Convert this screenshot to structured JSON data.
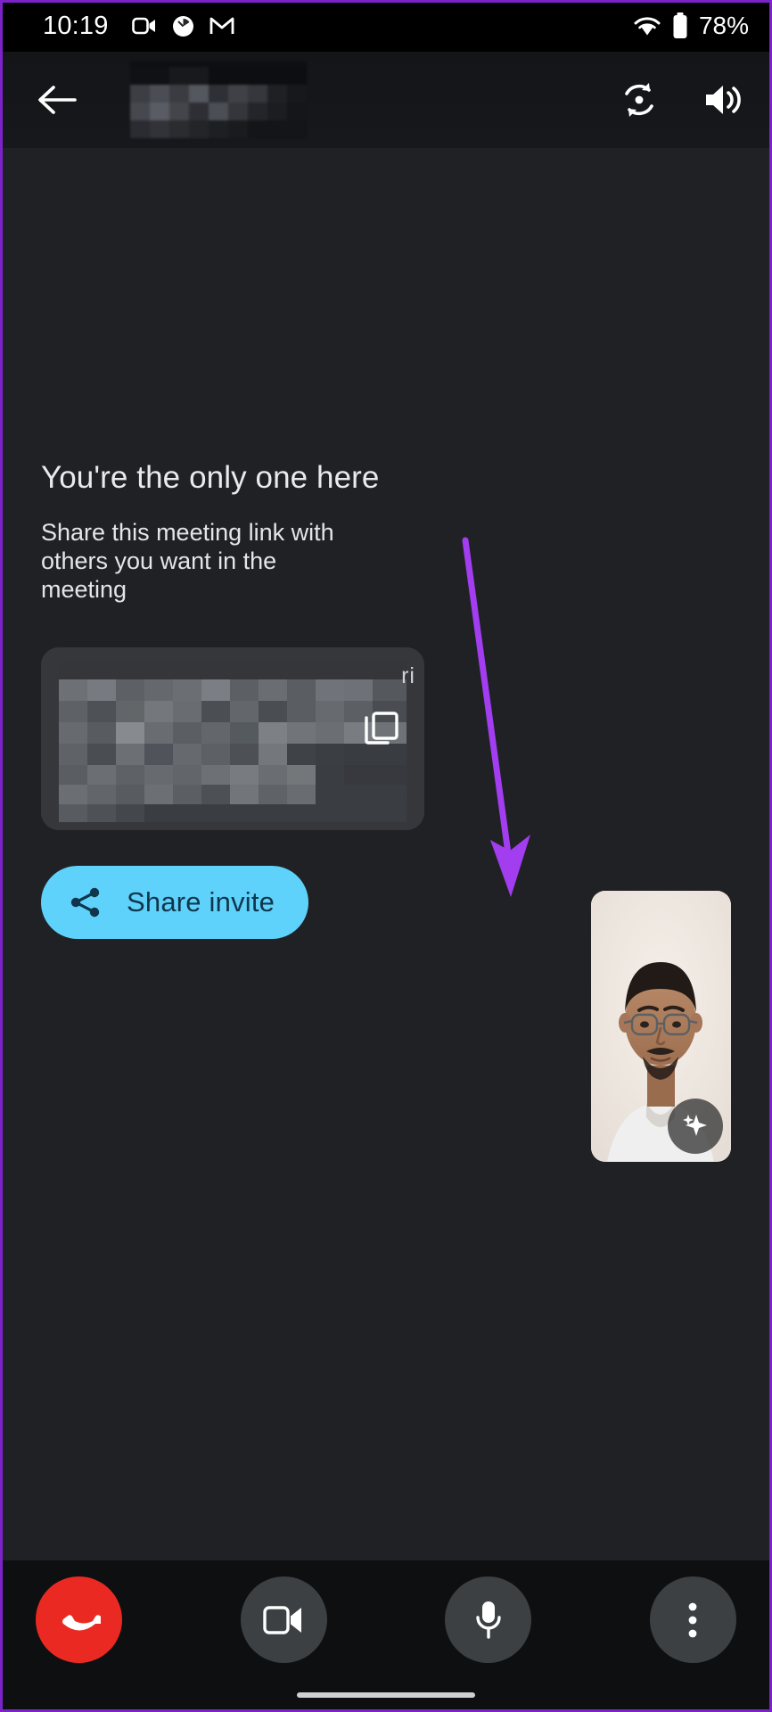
{
  "status_bar": {
    "time": "10:19",
    "battery_percent": "78%",
    "left_icons": [
      "video-camera-icon",
      "clock-circle-icon",
      "gmail-icon"
    ],
    "right_icons": [
      "wifi-icon",
      "battery-icon"
    ]
  },
  "app_bar": {
    "back_icon": "back-arrow-icon",
    "meeting_title": "",
    "meeting_title_state": "redacted",
    "switch_camera_icon": "switch-camera-icon",
    "speaker_icon": "speaker-volume-icon"
  },
  "main": {
    "headline": "You're the only one here",
    "subtext": "Share this meeting link with others you want in the meeting",
    "link_card": {
      "link_text": "",
      "link_text_state": "redacted",
      "visible_tail": "ri",
      "copy_icon": "copy-icon"
    },
    "share_button": {
      "label": "Share invite",
      "icon": "share-icon",
      "background_color": "#5ed2fb",
      "text_color": "#10364c"
    },
    "self_view": {
      "label": "self-view",
      "effects_icon": "sparkle-effects-icon"
    },
    "annotation": {
      "type": "arrow",
      "color": "#a23df0",
      "points_to": "self-view"
    }
  },
  "bottom_bar": {
    "controls": [
      {
        "name": "end-call-button",
        "icon": "phone-hangup-icon",
        "color": "#ea2a22"
      },
      {
        "name": "camera-button",
        "icon": "video-camera-icon",
        "color": "#3c4043"
      },
      {
        "name": "microphone-button",
        "icon": "microphone-icon",
        "color": "#3c4043"
      },
      {
        "name": "more-options-button",
        "icon": "more-vertical-icon",
        "color": "#3c4043"
      }
    ]
  },
  "colors": {
    "stage_bg": "#202124",
    "bar_bg": "#0e0f11",
    "accent": "#5ed2fb",
    "danger": "#ea2a22",
    "annotation_purple": "#a23df0"
  }
}
